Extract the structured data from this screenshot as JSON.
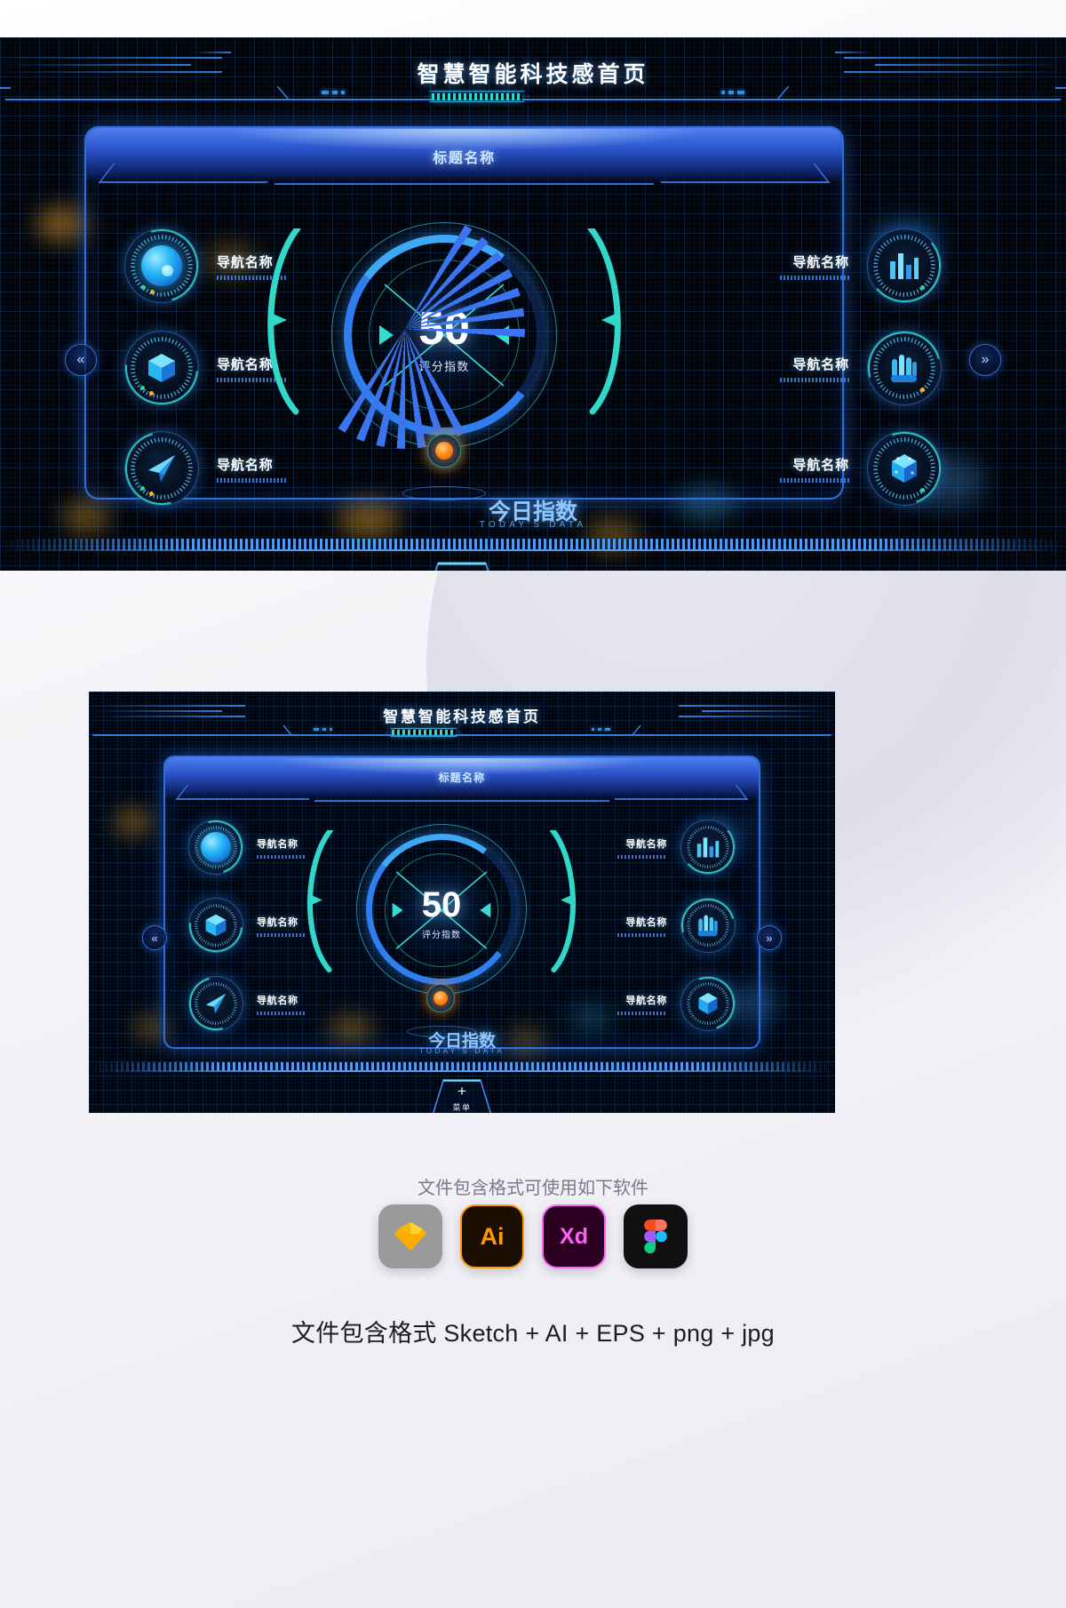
{
  "header": {
    "title": "智慧智能科技感首页"
  },
  "panel": {
    "title": "标题名称",
    "prev_arrow": "«",
    "next_arrow": "»"
  },
  "nav_left": [
    {
      "label": "导航名称",
      "icon": "sphere-icon"
    },
    {
      "label": "导航名称",
      "icon": "cube-icon"
    },
    {
      "label": "导航名称",
      "icon": "paper-plane-icon"
    }
  ],
  "nav_right": [
    {
      "label": "导航名称",
      "icon": "bar-chart-icon"
    },
    {
      "label": "导航名称",
      "icon": "fingerprint-icon"
    },
    {
      "label": "导航名称",
      "icon": "data-cube-icon"
    }
  ],
  "gauge": {
    "value": "50",
    "value_label": "评分指数",
    "today_cn": "今日指数",
    "today_en": "TODAY'S DATA"
  },
  "menu": {
    "plus": "+",
    "label": "菜单"
  },
  "footer": {
    "software_caption": "文件包含格式可使用如下软件",
    "apps": [
      {
        "name": "sketch",
        "label": "◆"
      },
      {
        "name": "illustrator",
        "label": "Ai"
      },
      {
        "name": "adobe-xd",
        "label": "Xd"
      },
      {
        "name": "figma",
        "label": ""
      }
    ],
    "formats": "文件包含格式 Sketch + AI + EPS + png + jpg"
  },
  "colors": {
    "accent_blue": "#2f7fe0",
    "accent_cyan": "#2bd9d0",
    "panel_border": "#2f6fd8",
    "orb_orange": "#ff7a1a",
    "bg_black": "#000308"
  },
  "chart_data": {
    "type": "gauge",
    "title": "评分指数",
    "value": 50,
    "min": 0,
    "max": 100,
    "unit": "",
    "series": [
      {
        "name": "评分指数",
        "values": [
          50
        ]
      }
    ]
  }
}
